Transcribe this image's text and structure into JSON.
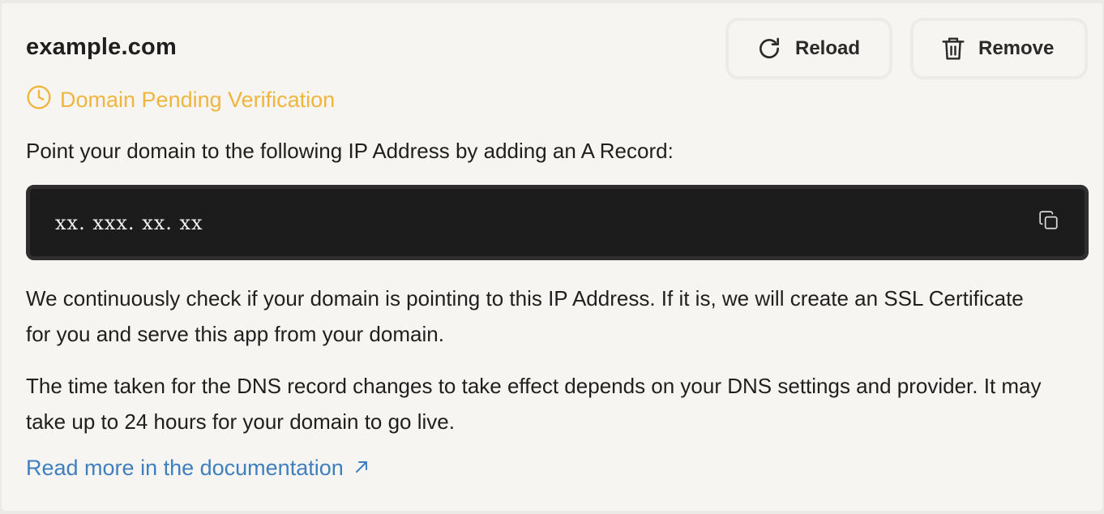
{
  "domain": {
    "name": "example.com"
  },
  "actions": {
    "reload_label": "Reload",
    "remove_label": "Remove"
  },
  "status": {
    "text": "Domain Pending Verification",
    "icon": "clock-icon",
    "color": "#f0b53f"
  },
  "instructions": {
    "intro": "Point your domain to the following IP Address by adding an A Record:",
    "ip_address": "xx. xxx. xx. xx",
    "check_text": "We continuously check if your domain is pointing to this IP Address. If it is, we will create an SSL Certificate for you and serve this app from your domain.",
    "timing_text": "The time taken for the DNS record changes to take effect depends on your DNS settings and provider. It may take up to 24 hours for your domain to go live."
  },
  "docs_link": {
    "label": "Read more in the documentation",
    "icon": "arrow-up-right-icon",
    "color": "#3f7fbf"
  }
}
